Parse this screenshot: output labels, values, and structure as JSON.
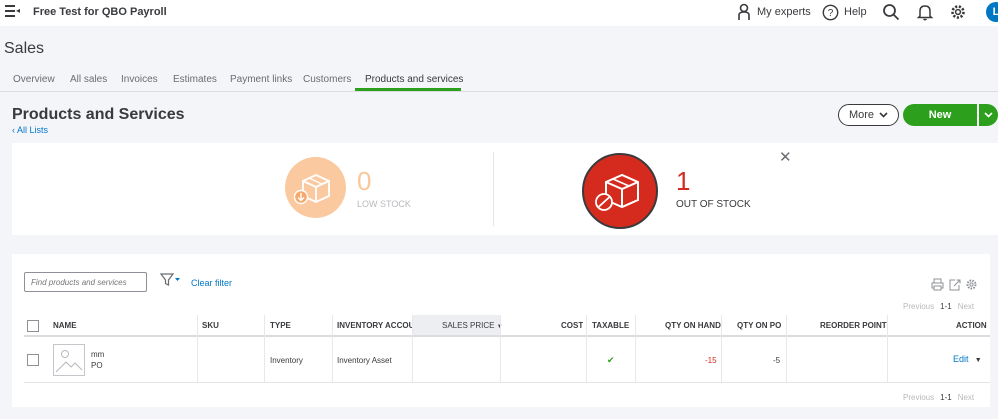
{
  "topbar": {
    "company": "Free Test for QBO Payroll",
    "my_experts": "My experts",
    "help": "Help",
    "avatar_initial": "L"
  },
  "page": {
    "section_title": "Sales",
    "title": "Products and Services",
    "all_lists": "All Lists"
  },
  "tabs": [
    "Overview",
    "All sales",
    "Invoices",
    "Estimates",
    "Payment links",
    "Customers",
    "Products and services"
  ],
  "active_tab": "Products and services",
  "buttons": {
    "more": "More",
    "new": "New",
    "clear_filter": "Clear filter"
  },
  "stock": {
    "low_count": "0",
    "low_label": "LOW STOCK",
    "out_count": "1",
    "out_label": "OUT OF STOCK"
  },
  "search": {
    "placeholder": "Find products and services"
  },
  "pagination": {
    "previous": "Previous",
    "range": "1-1",
    "next": "Next"
  },
  "table": {
    "columns": [
      "NAME",
      "SKU",
      "TYPE",
      "INVENTORY ACCOUN",
      "SALES PRICE",
      "COST",
      "TAXABLE",
      "QTY ON HAND",
      "QTY ON PO",
      "REORDER POINT",
      "ACTION"
    ],
    "rows": [
      {
        "name": "mm",
        "name_sub": "PO",
        "sku": "",
        "type": "Inventory",
        "inventory_account": "Inventory Asset",
        "sales_price": "",
        "cost": "",
        "taxable": "✔",
        "qty_on_hand": "-15",
        "qty_on_po": "-5",
        "reorder_point": "",
        "action": "Edit"
      }
    ]
  },
  "colors": {
    "green": "#2ca01c",
    "blue": "#0077c5",
    "red": "#d52b1e",
    "low_stock_orange": "#fbc9a0"
  }
}
